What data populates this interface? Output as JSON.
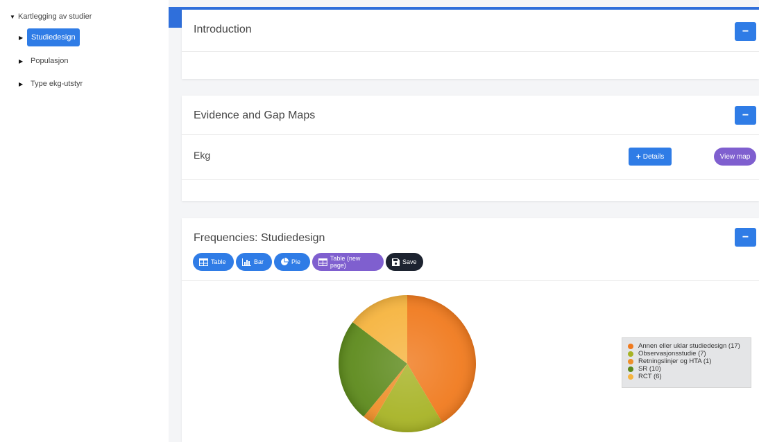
{
  "sidebar": {
    "root": {
      "label": "Kartlegging av studier",
      "expanded": true
    },
    "items": [
      {
        "label": "Studiedesign",
        "selected": true
      },
      {
        "label": "Populasjon",
        "selected": false
      },
      {
        "label": "Type ekg-utstyr",
        "selected": false
      }
    ]
  },
  "colors": {
    "primary": "#2f7ce6",
    "header": "#2f6fdb",
    "purple": "#7f5fcf",
    "dark": "#1d2330"
  },
  "intro": {
    "title": "Introduction",
    "collapse": "−"
  },
  "egm": {
    "title": "Evidence and Gap Maps",
    "collapse": "−",
    "row": {
      "label": "Ekg",
      "details": "Details",
      "view_map": "View map"
    }
  },
  "freq": {
    "title": "Frequencies: Studiedesign",
    "collapse": "−",
    "toolbar": {
      "table": "Table",
      "bar": "Bar",
      "pie": "Pie",
      "table_new": "Table (new page)",
      "save": "Save"
    }
  },
  "chart_data": {
    "type": "pie",
    "legend_position": "right",
    "slices": [
      {
        "label": "Annen eller uklar studiedesign (17)",
        "value": 17,
        "color": "#f07a1e"
      },
      {
        "label": "Observasjonsstudie (7)",
        "value": 7,
        "color": "#a7b325"
      },
      {
        "label": "Retningslinjer og HTA (1)",
        "value": 1,
        "color": "#ee8f2a"
      },
      {
        "label": "SR (10)",
        "value": 10,
        "color": "#5d8a1c"
      },
      {
        "label": "RCT (6)",
        "value": 6,
        "color": "#f6b43f"
      }
    ]
  }
}
